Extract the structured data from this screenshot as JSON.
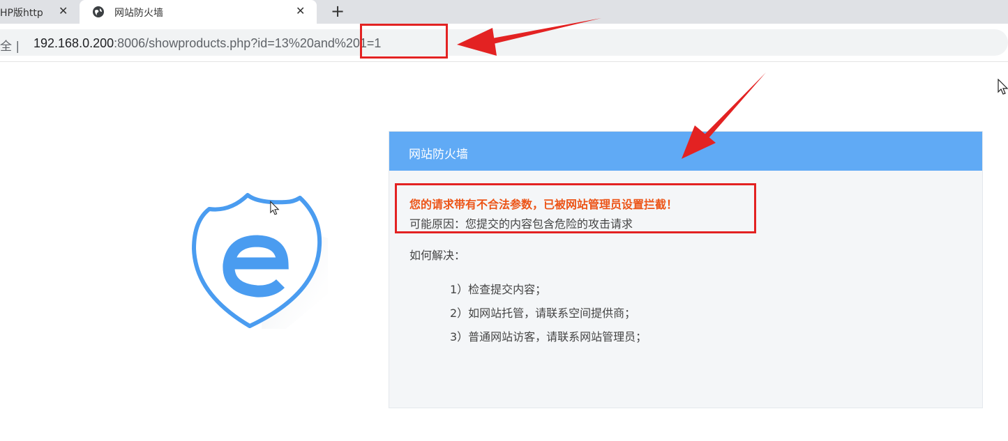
{
  "tabs": [
    {
      "title": "HP版http",
      "active": false,
      "close": "✕"
    },
    {
      "title": "网站防火墙",
      "active": true,
      "close": "✕",
      "icon": "globe-icon"
    }
  ],
  "new_tab_symbol": "+",
  "address_bar": {
    "security_label": "全 |",
    "url_host": "192.168.0.200",
    "url_port": ":8006",
    "url_path": "/showproducts.php?id=13%20and%201=1"
  },
  "firewall": {
    "title": "网站防火墙",
    "alert": "您的请求带有不合法参数，已被网站管理员设置拦截！",
    "reason": "可能原因：您提交的内容包含危险的攻击请求",
    "how_to_solve": "如何解决：",
    "solutions": [
      "1）检查提交内容；",
      "2）如网站托管，请联系空间提供商；",
      "3）普通网站访客，请联系网站管理员；"
    ],
    "logo_icon": "shield-e-icon"
  },
  "colors": {
    "header_blue": "#60aaf5",
    "alert_orange": "#ec5417",
    "annotation_red": "#e32222",
    "logo_blue": "#4a9cf0"
  }
}
